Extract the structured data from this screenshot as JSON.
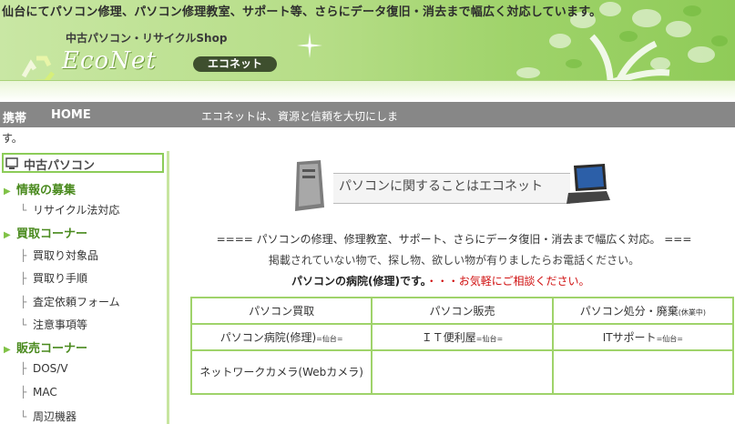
{
  "header": {
    "tagline": "仙台にてパソコン修理、パソコン修理教室、サポート等、さらにデータ復旧・消去まで幅広く対応しています。",
    "shop_name": "中古パソコン・リサイクルShop",
    "logo_text": "EcoNet",
    "kana_badge": "エコネット"
  },
  "nav": {
    "mobile": "携帯",
    "home": "HOME",
    "motto": "エコネットは、資源と信頼を大切にしま",
    "motto_end": "す。"
  },
  "sidebar": {
    "title": "中古パソコン",
    "sections": [
      {
        "label": "情報の募集",
        "items": [
          {
            "label": "リサイクル法対応"
          }
        ]
      },
      {
        "label": "買取コーナー",
        "items": [
          {
            "label": "買取り対象品"
          },
          {
            "label": "買取り手順"
          },
          {
            "label": "査定依頼フォーム"
          },
          {
            "label": "注意事項等"
          }
        ]
      },
      {
        "label": "販売コーナー",
        "items": [
          {
            "label": "DOS/V"
          },
          {
            "label": "MAC"
          },
          {
            "label": "周辺機器"
          }
        ]
      }
    ]
  },
  "main": {
    "banner_text": "パソコンに関することはエコネット",
    "intro": "==== パソコンの修理、修理教室、サポート、さらにデータ復旧・消去まで幅広く対応。 ===",
    "sub": "掲載されていない物で、探し物、欲しい物が有りましたらお電話ください。",
    "hospital_label": "パソコンの病院(修理)です。",
    "hospital_note": "・・・お気軽にご相談ください。",
    "services": [
      [
        {
          "text": "パソコン買取",
          "small": ""
        },
        {
          "text": "パソコン販売",
          "small": ""
        },
        {
          "text": "パソコン処分・廃棄",
          "small": "(休業中)"
        }
      ],
      [
        {
          "text": "パソコン病院(修理)",
          "small": "=仙台="
        },
        {
          "text": "ＩＴ便利屋",
          "small": "=仙台="
        },
        {
          "text": "ITサポート",
          "small": "=仙台="
        }
      ],
      [
        {
          "text": "ネットワークカメラ(Webカメラ)",
          "small": ""
        },
        {
          "text": "",
          "small": ""
        },
        {
          "text": "",
          "small": ""
        }
      ]
    ]
  },
  "colors": {
    "accent_green": "#4a8a1e",
    "border_green": "#9fd36a",
    "nav_gray": "#878787",
    "alert_red": "#d01010"
  },
  "icons": [
    "recycle-logo-icon",
    "sparkle-icon",
    "tree-icon",
    "monitor-icon",
    "arrow-icon",
    "pc-tower-icon",
    "laptop-icon"
  ]
}
